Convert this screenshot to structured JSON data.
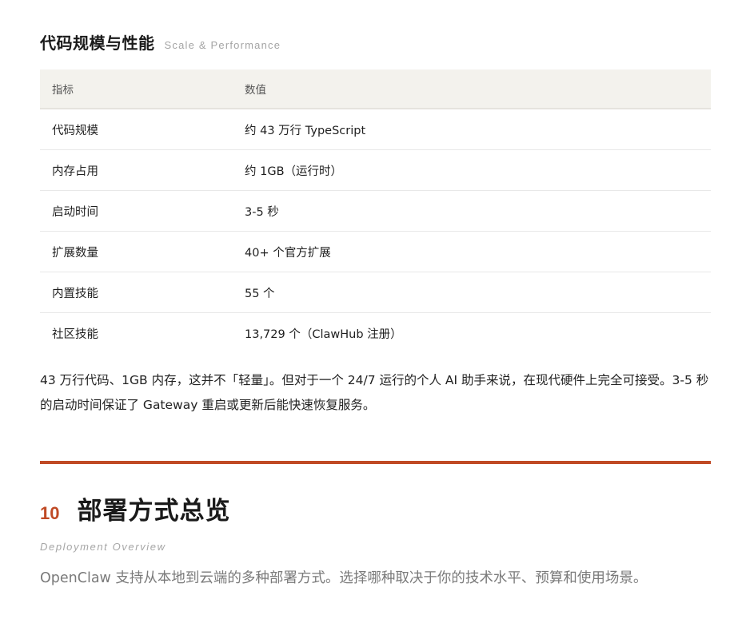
{
  "scale_section": {
    "title": "代码规模与性能",
    "subtitle": "Scale & Performance",
    "table": {
      "headers": [
        "指标",
        "数值"
      ],
      "rows": [
        {
          "metric": "代码规模",
          "value": "约 43 万行 TypeScript"
        },
        {
          "metric": "内存占用",
          "value": "约 1GB（运行时）"
        },
        {
          "metric": "启动时间",
          "value": "3-5 秒"
        },
        {
          "metric": "扩展数量",
          "value": "40+ 个官方扩展"
        },
        {
          "metric": "内置技能",
          "value": "55 个"
        },
        {
          "metric": "社区技能",
          "value": "13,729 个（ClawHub 注册）"
        }
      ]
    },
    "paragraph": "43 万行代码、1GB 内存，这并不「轻量」。但对于一个 24/7 运行的个人 AI 助手来说，在现代硬件上完全可接受。3-5 秒的启动时间保证了 Gateway 重启或更新后能快速恢复服务。"
  },
  "chapter": {
    "number": "10",
    "title": "部署方式总览",
    "subtitle": "Deployment Overview",
    "intro": "OpenClaw 支持从本地到云端的多种部署方式。选择哪种取决于你的技术水平、预算和使用场景。"
  },
  "colors": {
    "accent": "#c04a25",
    "table_header_bg": "#f3f2ed"
  }
}
